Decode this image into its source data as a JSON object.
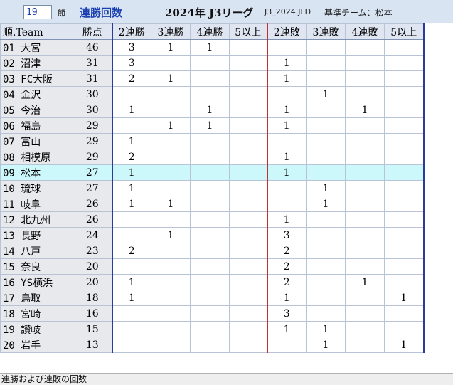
{
  "toolbar": {
    "round_value": "19",
    "round_label": "節",
    "view_title": "連勝回数",
    "league_title": "2024年 J3リーグ",
    "file_name": "J3_2024.JLD",
    "base_team": "基準チーム：松本"
  },
  "table": {
    "headers": [
      "順.Team",
      "勝点",
      "2連勝",
      "3連勝",
      "4連勝",
      "5以上",
      "2連敗",
      "3連敗",
      "4連敗",
      "5以上"
    ],
    "highlight_row": 8,
    "rows": [
      {
        "team": "01 大宮",
        "pts": "46",
        "cells": [
          "3",
          "1",
          "1",
          "",
          "",
          "",
          "",
          ""
        ]
      },
      {
        "team": "02 沼津",
        "pts": "31",
        "cells": [
          "3",
          "",
          "",
          "",
          "1",
          "",
          "",
          ""
        ]
      },
      {
        "team": "03 FC大阪",
        "pts": "31",
        "cells": [
          "2",
          "1",
          "",
          "",
          "1",
          "",
          "",
          ""
        ]
      },
      {
        "team": "04 金沢",
        "pts": "30",
        "cells": [
          "",
          "",
          "",
          "",
          "",
          "1",
          "",
          ""
        ]
      },
      {
        "team": "05 今治",
        "pts": "30",
        "cells": [
          "1",
          "",
          "1",
          "",
          "1",
          "",
          "1",
          ""
        ]
      },
      {
        "team": "06 福島",
        "pts": "29",
        "cells": [
          "",
          "1",
          "1",
          "",
          "1",
          "",
          "",
          ""
        ]
      },
      {
        "team": "07 富山",
        "pts": "29",
        "cells": [
          "1",
          "",
          "",
          "",
          "",
          "",
          "",
          ""
        ]
      },
      {
        "team": "08 相模原",
        "pts": "29",
        "cells": [
          "2",
          "",
          "",
          "",
          "1",
          "",
          "",
          ""
        ]
      },
      {
        "team": "09 松本",
        "pts": "27",
        "cells": [
          "1",
          "",
          "",
          "",
          "1",
          "",
          "",
          ""
        ]
      },
      {
        "team": "10 琉球",
        "pts": "27",
        "cells": [
          "1",
          "",
          "",
          "",
          "",
          "1",
          "",
          ""
        ]
      },
      {
        "team": "11 岐阜",
        "pts": "26",
        "cells": [
          "1",
          "1",
          "",
          "",
          "",
          "1",
          "",
          ""
        ]
      },
      {
        "team": "12 北九州",
        "pts": "26",
        "cells": [
          "",
          "",
          "",
          "",
          "1",
          "",
          "",
          ""
        ]
      },
      {
        "team": "13 長野",
        "pts": "24",
        "cells": [
          "",
          "1",
          "",
          "",
          "3",
          "",
          "",
          ""
        ]
      },
      {
        "team": "14 八戸",
        "pts": "23",
        "cells": [
          "2",
          "",
          "",
          "",
          "2",
          "",
          "",
          ""
        ]
      },
      {
        "team": "15 奈良",
        "pts": "20",
        "cells": [
          "",
          "",
          "",
          "",
          "2",
          "",
          "",
          ""
        ]
      },
      {
        "team": "16 YS横浜",
        "pts": "20",
        "cells": [
          "1",
          "",
          "",
          "",
          "2",
          "",
          "1",
          ""
        ]
      },
      {
        "team": "17 鳥取",
        "pts": "18",
        "cells": [
          "1",
          "",
          "",
          "",
          "1",
          "",
          "",
          "1"
        ]
      },
      {
        "team": "18 宮崎",
        "pts": "16",
        "cells": [
          "",
          "",
          "",
          "",
          "3",
          "",
          "",
          ""
        ]
      },
      {
        "team": "19 讃岐",
        "pts": "15",
        "cells": [
          "",
          "",
          "",
          "",
          "1",
          "1",
          "",
          ""
        ]
      },
      {
        "team": "20 岩手",
        "pts": "13",
        "cells": [
          "",
          "",
          "",
          "",
          "",
          "1",
          "",
          "1"
        ]
      }
    ]
  },
  "status": {
    "text": "連勝および連敗の回数"
  }
}
